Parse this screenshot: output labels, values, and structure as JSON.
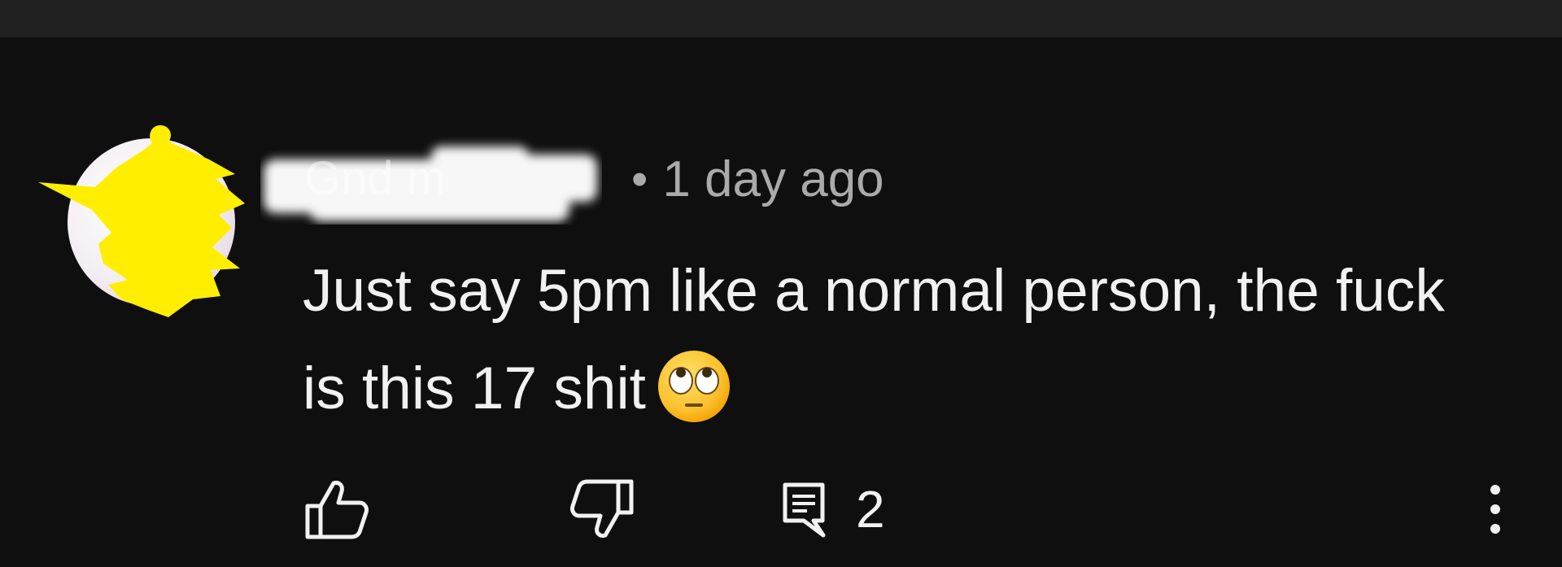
{
  "comment": {
    "author": "Gnd   m",
    "separator": "•",
    "timestamp": "1 day ago",
    "text": "Just say 5pm like a normal person, the fuck is this 17 shit",
    "emoji": "face-with-rolling-eyes"
  },
  "actions": {
    "like_icon": "thumbs-up-icon",
    "dislike_icon": "thumbs-down-icon",
    "reply_icon": "comment-icon",
    "reply_count": "2",
    "more_icon": "more-vertical-icon"
  },
  "colors": {
    "background": "#0f0f0f",
    "top_bar": "#212121",
    "primary_text": "#f1f1f1",
    "secondary_text": "#aaaaaa",
    "avatar_redaction": "#ffee00"
  }
}
